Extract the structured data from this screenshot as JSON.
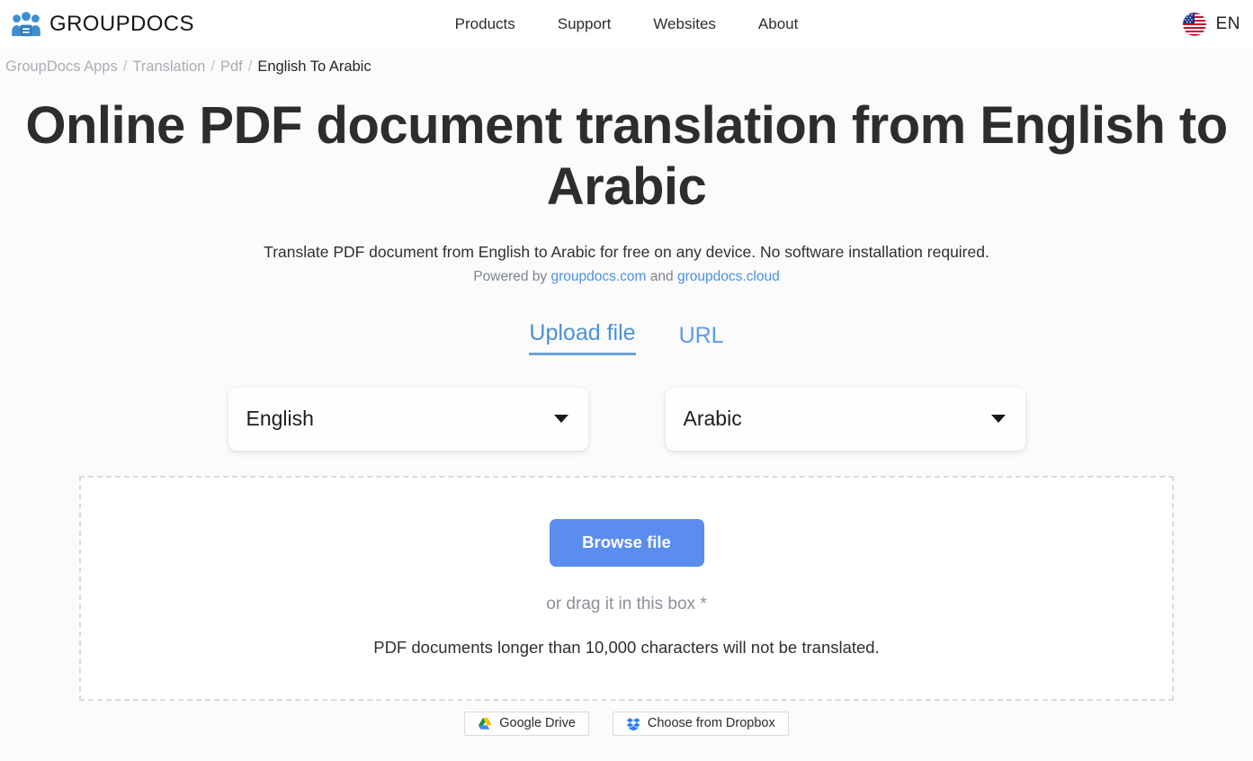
{
  "header": {
    "brand_name": "GROUPDOCS",
    "brand_icon": "groupdocs-people-logo",
    "nav": [
      {
        "label": "Products"
      },
      {
        "label": "Support"
      },
      {
        "label": "Websites"
      },
      {
        "label": "About"
      }
    ],
    "language": {
      "code": "EN",
      "flag_icon": "us-flag-icon"
    }
  },
  "breadcrumb": {
    "items": [
      {
        "label": "GroupDocs Apps",
        "current": false
      },
      {
        "label": "Translation",
        "current": false
      },
      {
        "label": "Pdf",
        "current": false
      },
      {
        "label": "English To Arabic",
        "current": true
      }
    ],
    "separator": "/"
  },
  "hero": {
    "title": "Online PDF document translation from English to Arabic",
    "subtitle": "Translate PDF document from English to Arabic for free on any device. No software installation required.",
    "powered_prefix": "Powered by",
    "powered_link_1": "groupdocs.com",
    "powered_conjunction": "and",
    "powered_link_2": "groupdocs.cloud"
  },
  "tabs": [
    {
      "label": "Upload file",
      "active": true
    },
    {
      "label": "URL",
      "active": false
    }
  ],
  "selects": {
    "source": {
      "value": "English",
      "caret_icon": "chevron-down-icon"
    },
    "target": {
      "value": "Arabic",
      "caret_icon": "chevron-down-icon"
    }
  },
  "dropzone": {
    "browse_label": "Browse file",
    "drag_hint": "or drag it in this box *",
    "limit_note": "PDF documents longer than 10,000 characters will not be translated."
  },
  "cloud_buttons": [
    {
      "label": "Google Drive",
      "icon": "google-drive-icon"
    },
    {
      "label": "Choose from Dropbox",
      "icon": "dropbox-icon"
    }
  ],
  "colors": {
    "accent_blue": "#5b8def",
    "link_blue": "#4a90e2",
    "tab_blue": "#5d9cec",
    "page_bg": "#fbfbfb",
    "heading": "#2d2d30",
    "muted": "#a9adb3"
  }
}
